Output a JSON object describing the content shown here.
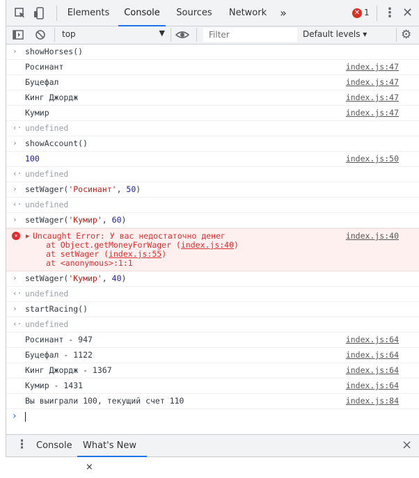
{
  "tabs": {
    "elements": "Elements",
    "console": "Console",
    "sources": "Sources",
    "network": "Network",
    "more": "»",
    "error_count": "1"
  },
  "toolbar": {
    "context": "top",
    "filter_placeholder": "Filter",
    "levels": "Default levels ▾"
  },
  "log": {
    "cmd1": "showHorses()",
    "out1": [
      {
        "text": "Росинант",
        "src": "index.js:47"
      },
      {
        "text": "Буцефал",
        "src": "index.js:47"
      },
      {
        "text": "Кинг Джордж",
        "src": "index.js:47"
      },
      {
        "text": "Кумир",
        "src": "index.js:47"
      }
    ],
    "undefined": "undefined",
    "cmd2": "showAccount()",
    "out2": {
      "text": "100",
      "src": "index.js:50"
    },
    "cmd3": {
      "fn": "setWager(",
      "str": "'Росинант'",
      "sep": ", ",
      "num": "50",
      "end": ")"
    },
    "cmd4": {
      "fn": "setWager(",
      "str": "'Кумир'",
      "sep": ", ",
      "num": "60",
      "end": ")"
    },
    "error": {
      "message": "Uncaught Error: У вас недостаточно денег",
      "src": "index.js:40",
      "line2_prefix": "at Object.getMoneyForWager (",
      "line2_link": "index.js:40",
      "line2_suffix": ")",
      "line3_prefix": "at setWager (",
      "line3_link": "index.js:55",
      "line3_suffix": ")",
      "line4": "at <anonymous>:1:1"
    },
    "cmd5": {
      "fn": "setWager(",
      "str": "'Кумир'",
      "sep": ", ",
      "num": "40",
      "end": ")"
    },
    "cmd6": "startRacing()",
    "out6": [
      {
        "text": "Росинант - 947",
        "src": "index.js:64"
      },
      {
        "text": "Буцефал - 1122",
        "src": "index.js:64"
      },
      {
        "text": "Кинг Джордж - 1367",
        "src": "index.js:64"
      },
      {
        "text": "Кумир - 1431",
        "src": "index.js:64"
      },
      {
        "text": "Вы выиграли 100, текущий счет 110",
        "src": "index.js:84"
      }
    ]
  },
  "drawer": {
    "console": "Console",
    "whats_new": "What's New",
    "close_tab": "×",
    "close": "×"
  }
}
